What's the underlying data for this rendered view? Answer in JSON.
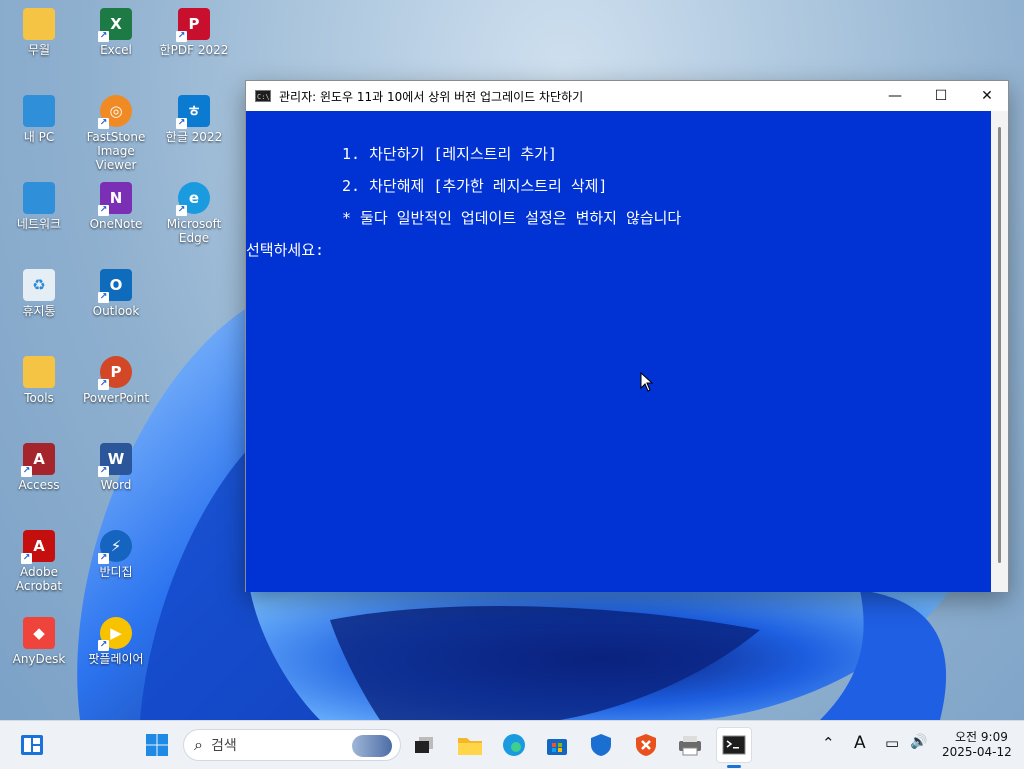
{
  "desktop": {
    "icons": [
      {
        "label": "무월",
        "icon": "folder-icon",
        "color": "#f6c445"
      },
      {
        "label": "Excel",
        "icon": "excel-icon",
        "color": "#1d7a45"
      },
      {
        "label": "한PDF 2022",
        "icon": "hanpdf-icon",
        "color": "#c8102e"
      },
      {
        "label": "내 PC",
        "icon": "monitor-icon",
        "color": "#2f8fd8"
      },
      {
        "label": "FastStone Image Viewer",
        "icon": "faststone-icon",
        "color": "#f08a24"
      },
      {
        "label": "한글 2022",
        "icon": "hangul-icon",
        "color": "#0b7ad1"
      },
      {
        "label": "네트워크",
        "icon": "network-icon",
        "color": "#2f8fd8"
      },
      {
        "label": "OneNote",
        "icon": "onenote-icon",
        "color": "#7b2fb5"
      },
      {
        "label": "Microsoft Edge",
        "icon": "edge-icon",
        "color": "#1a9be0"
      },
      {
        "label": "휴지통",
        "icon": "recycle-bin-icon",
        "color": "#e6eef5"
      },
      {
        "label": "Outlook",
        "icon": "outlook-icon",
        "color": "#0f6cbd"
      },
      {
        "label": "Tools",
        "icon": "folder-icon",
        "color": "#f6c445"
      },
      {
        "label": "PowerPoint",
        "icon": "powerpoint-icon",
        "color": "#d24726"
      },
      {
        "label": "Access",
        "icon": "access-icon",
        "color": "#a4262c"
      },
      {
        "label": "Word",
        "icon": "word-icon",
        "color": "#2b579a"
      },
      {
        "label": "Adobe Acrobat",
        "icon": "acrobat-icon",
        "color": "#c50f0f"
      },
      {
        "label": "반디집",
        "icon": "bandizip-icon",
        "color": "#1565c0"
      },
      {
        "label": "AnyDesk",
        "icon": "anydesk-icon",
        "color": "#ef443b"
      },
      {
        "label": "팟플레이어",
        "icon": "potplayer-icon",
        "color": "#f7c300"
      }
    ]
  },
  "window": {
    "title": "관리자:  윈도우 11과 10에서 상위 버전 업그레이드 차단하기",
    "icon_text": "C:\\",
    "minimize": "—",
    "maximize": "☐",
    "close": "✕",
    "console_bg": "#0032d4",
    "lines": [
      "1. 차단하기 [레지스트리 추가]",
      "2. 차단해제 [추가한 레지스트리 삭제]",
      "* 둘다 일반적인 업데이트 설정은 변하지 않습니다",
      "선택하세요:"
    ]
  },
  "taskbar": {
    "search_placeholder": "검색",
    "icons": [
      "widgets-icon",
      "start-icon",
      "task-view-icon",
      "file-explorer-icon",
      "edge-icon",
      "store-icon",
      "defender-icon",
      "avast-icon",
      "printer-icon",
      "terminal-icon"
    ],
    "tray": {
      "ime": "A",
      "time": "오전 9:09",
      "date": "2025-04-12"
    }
  }
}
